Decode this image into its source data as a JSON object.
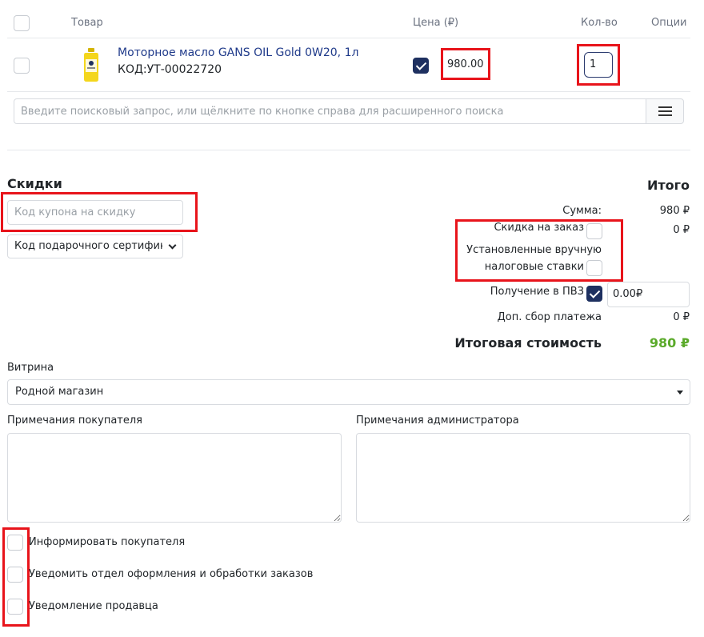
{
  "table": {
    "headers": {
      "product": "Товар",
      "price": "Цена (₽)",
      "qty": "Кол-во",
      "options": "Опции"
    },
    "row": {
      "name": "Моторное масло GANS OIL Gold 0W20, 1л",
      "code": "КОД:УТ-00022720",
      "price": "980.00",
      "qty": "1"
    }
  },
  "search": {
    "placeholder": "Введите поисковый запрос, или щёлкните по кнопке справа для расширенного поиска"
  },
  "discounts": {
    "title": "Скидки",
    "coupon_placeholder": "Код купона на скидку",
    "certificate_selected": "Код подарочного сертификата"
  },
  "totals": {
    "title": "Итого",
    "sum_label": "Сумма:",
    "sum_value": "980 ₽",
    "order_discount_label": "Скидка на заказ",
    "order_discount_value": "0 ₽",
    "manual_tax_line1": "Установленные вручную",
    "manual_tax_line2": "налоговые ставки",
    "pickup_label": "Получение в ПВЗ",
    "pickup_value": "0.00₽",
    "fee_label": "Доп. сбор платежа",
    "fee_value": "0 ₽",
    "final_label": "Итоговая стоимость",
    "final_value": "980 ₽"
  },
  "storefront": {
    "label": "Витрина",
    "selected": "Родной магазин"
  },
  "notes": {
    "customer_label": "Примечания покупателя",
    "admin_label": "Примечания администратора"
  },
  "notify": {
    "customer": "Информировать покупателя",
    "department": "Уведомить отдел оформления и обработки заказов",
    "seller": "Уведомление продавца"
  },
  "colors": {
    "accent": "#1e3060",
    "link": "#1f3a8a",
    "total_green": "#5aaa2a",
    "highlight": "#e8141b"
  }
}
